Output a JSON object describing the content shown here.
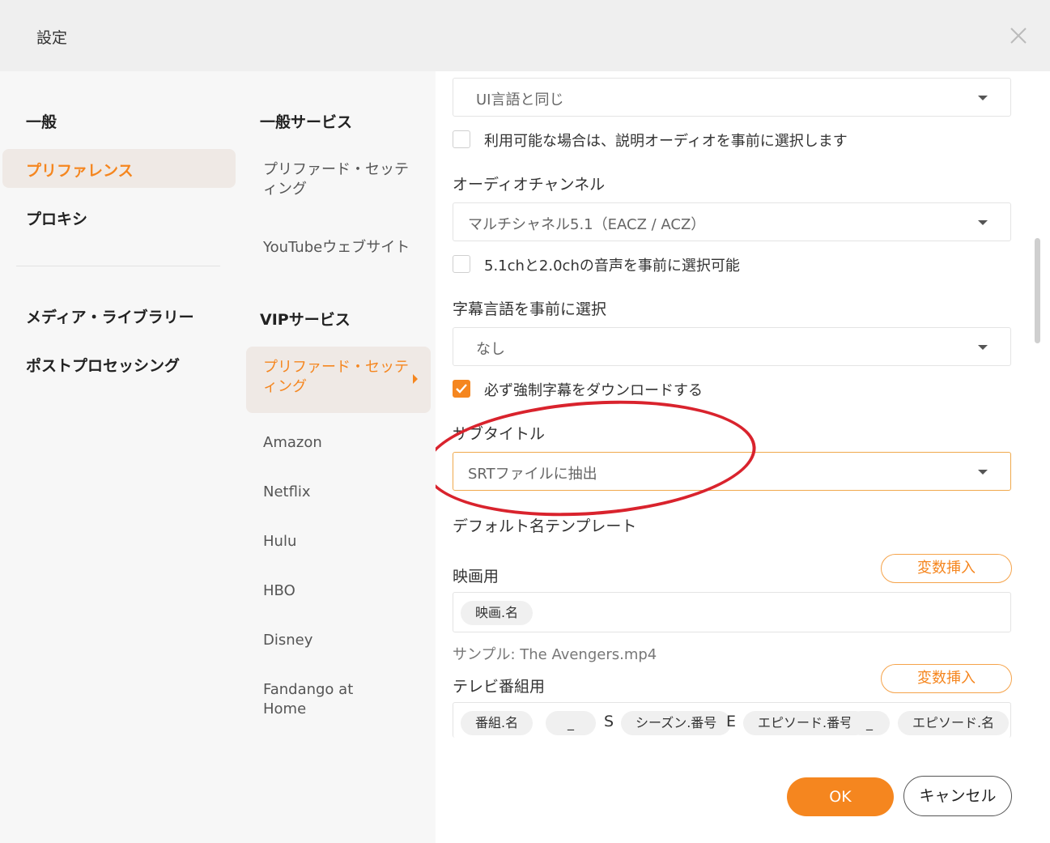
{
  "window": {
    "title": "設定"
  },
  "nav": {
    "general": "一般",
    "preferences": "プリファレンス",
    "proxy": "プロキシ",
    "media_library": "メディア・ライブラリー",
    "post_processing": "ポストプロセッシング"
  },
  "services": {
    "general_header": "一般サービス",
    "general_items": [
      "プリファード・セッティング",
      "YouTubeウェブサイト"
    ],
    "vip_header": "VIPサービス",
    "vip_items": [
      "プリファード・セッティング",
      "Amazon",
      "Netflix",
      "Hulu",
      "HBO",
      "Disney",
      "Fandango at Home"
    ]
  },
  "settings": {
    "audio_language_value": "UI言語と同じ",
    "audio_description_label": "利用可能な場合は、説明オーディオを事前に選択します",
    "audio_description_checked": false,
    "audio_channel_label": "オーディオチャンネル",
    "audio_channel_value": "マルチシャネル5.1（EACZ / ACZ）",
    "channel_option_label": "5.1chと2.0chの音声を事前に選択可能",
    "channel_option_checked": false,
    "subtitle_lang_label": "字幕言語を事前に選択",
    "subtitle_lang_value": "なし",
    "forced_subs_label": "必ず強制字幕をダウンロードする",
    "forced_subs_checked": true,
    "subtitle_label": "サブタイトル",
    "subtitle_value": "SRTファイルに抽出",
    "template_label": "デフォルト名テンプレート",
    "movie_label": "映画用",
    "insert_var_label": "変数挿入",
    "movie_chips": [
      "映画.名"
    ],
    "movie_sample": "サンプル: The Avengers.mp4",
    "tv_label": "テレビ番組用",
    "tv_tokens": {
      "t1": "番組.名",
      "t2": "_",
      "t3": "S",
      "t4": "シーズン.番号",
      "t5": "E",
      "t6": "エピソード.番号",
      "t7": "_",
      "t8": "エピソード.名"
    }
  },
  "footer": {
    "ok": "OK",
    "cancel": "キャンセル"
  },
  "colors": {
    "accent": "#f5861f",
    "annotation": "#d9232d"
  }
}
